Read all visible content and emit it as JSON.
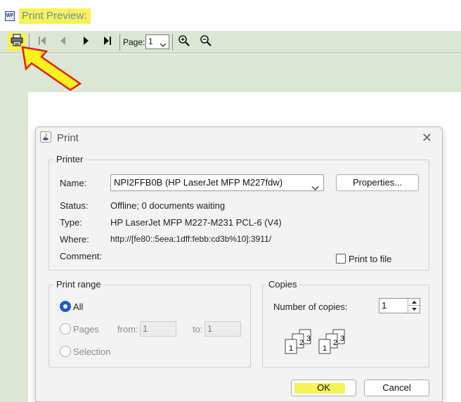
{
  "window": {
    "app_icon_text": "WF",
    "title": "Print Preview:"
  },
  "toolbar": {
    "page_label": "Page:",
    "page_value": "1",
    "icons": [
      "printer-icon",
      "first-page-icon",
      "previous-page-icon",
      "next-page-icon",
      "last-page-icon",
      "zoom-in-icon",
      "zoom-out-icon"
    ]
  },
  "dialog": {
    "title": "Print",
    "close_glyph": "✕",
    "printer": {
      "legend": "Printer",
      "name_label": "Name:",
      "name_value": "NPI2FFB0B (HP LaserJet MFP M227fdw)",
      "properties_label": "Properties...",
      "status_label": "Status:",
      "status_value": "Offline; 0 documents waiting",
      "type_label": "Type:",
      "type_value": "HP LaserJet MFP M227-M231 PCL-6 (V4)",
      "where_label": "Where:",
      "where_value": "http://[fe80::5eea:1dff:febb:cd3b%10]:3911/",
      "comment_label": "Comment:",
      "print_to_file_label": "Print to file",
      "print_to_file_checked": false
    },
    "range": {
      "legend": "Print range",
      "all_label": "All",
      "pages_label": "Pages",
      "from_label": "from:",
      "from_value": "1",
      "to_label": "to:",
      "to_value": "1",
      "selection_label": "Selection",
      "selected": "All"
    },
    "copies": {
      "legend": "Copies",
      "number_label": "Number of copies:",
      "number_value": "1",
      "collate_pages": [
        "1",
        "2",
        "3",
        "1",
        "2",
        "3"
      ]
    },
    "ok_label": "OK",
    "cancel_label": "Cancel"
  },
  "colors": {
    "highlight": "#f6f25a",
    "toolbar_bg": "#dbe7d4",
    "radio_accent": "#1f5fbf"
  }
}
